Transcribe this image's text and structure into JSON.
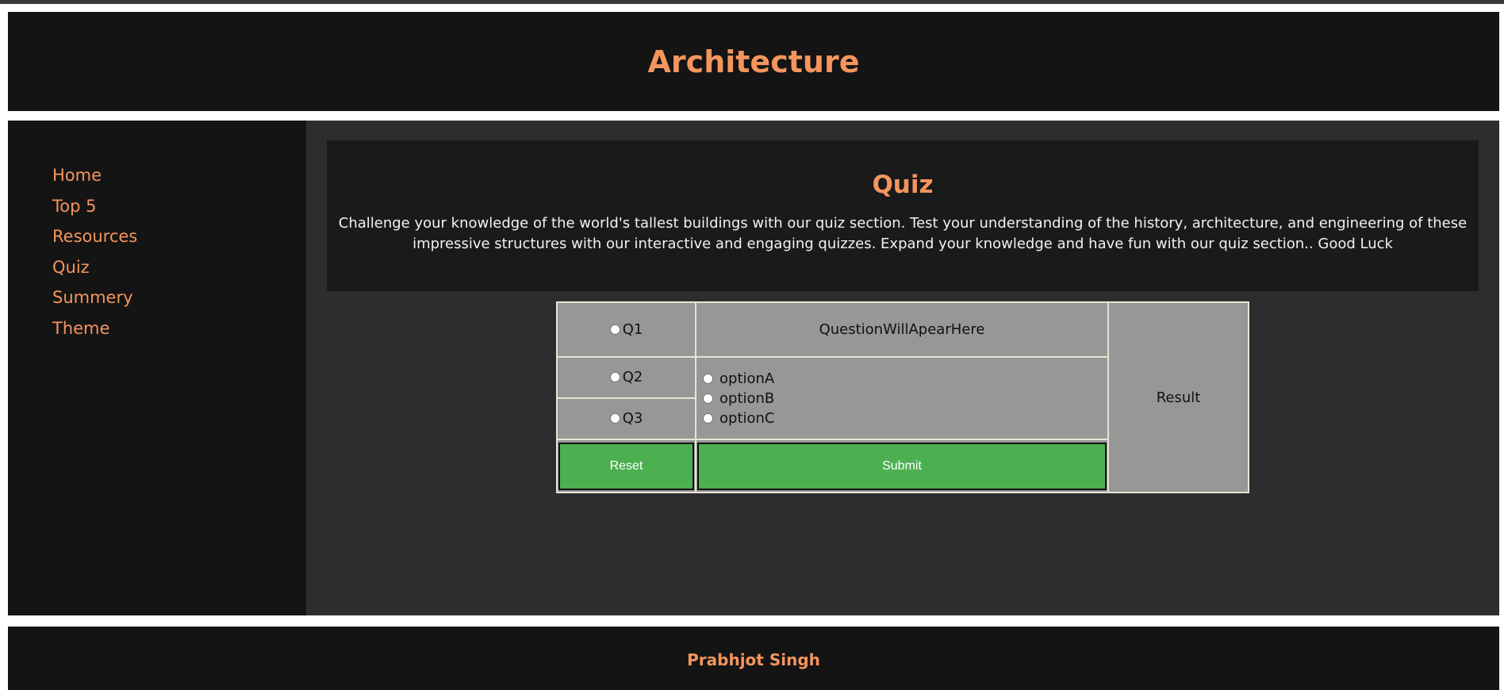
{
  "header": {
    "title": "Architecture"
  },
  "sidebar": {
    "items": [
      {
        "label": "Home"
      },
      {
        "label": "Top 5"
      },
      {
        "label": "Resources"
      },
      {
        "label": "Quiz"
      },
      {
        "label": "Summery"
      },
      {
        "label": "Theme"
      }
    ]
  },
  "intro": {
    "title": "Quiz",
    "text": "Challenge your knowledge of the world's tallest buildings with our quiz section. Test your understanding of the history, architecture, and engineering of these impressive structures with our interactive and engaging quizzes. Expand your knowledge and have fun with our quiz section.. Good Luck"
  },
  "quiz": {
    "questions": [
      {
        "label": "Q1",
        "selected": false
      },
      {
        "label": "Q2",
        "selected": false
      },
      {
        "label": "Q3",
        "selected": false
      }
    ],
    "question_text": "QuestionWillApearHere",
    "options": [
      {
        "label": "optionA",
        "selected": false
      },
      {
        "label": "optionB",
        "selected": false
      },
      {
        "label": "optionC",
        "selected": false
      }
    ],
    "result_text": "Result",
    "reset_label": "Reset",
    "submit_label": "Submit"
  },
  "footer": {
    "author": "Prabhjot Singh"
  },
  "colors": {
    "accent": "#f4955e",
    "button": "#4caf50",
    "panel": "#979797",
    "dark": "#141414"
  }
}
